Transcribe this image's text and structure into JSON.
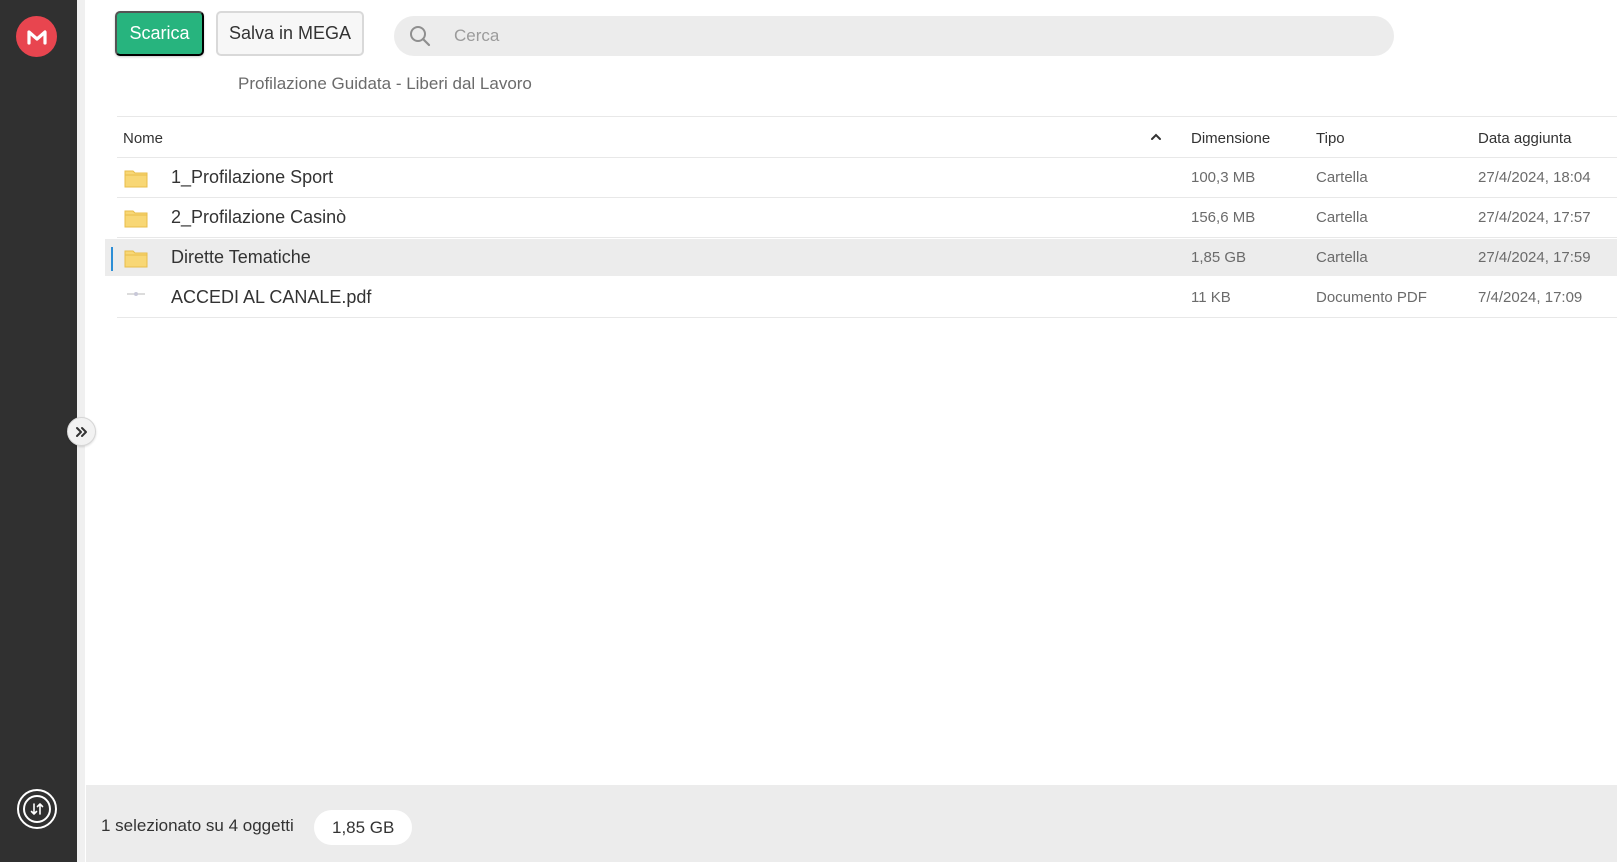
{
  "app": {
    "brand_color": "#e8454f",
    "accent_color": "#27b47e",
    "selection_color": "#2c8ed6"
  },
  "sidebar": {
    "logo_icon": "mega-logo-icon",
    "transfer_icon": "transfers-icon",
    "expand_icon": "chevron-double-right-icon"
  },
  "toolbar": {
    "download_label": "Scarica",
    "save_label": "Salva in MEGA"
  },
  "search": {
    "placeholder": "Cerca",
    "value": ""
  },
  "breadcrumb": {
    "folder_name": "Profilazione Guidata - Liberi dal Lavoro"
  },
  "table": {
    "columns": {
      "name": "Nome",
      "size": "Dimensione",
      "type": "Tipo",
      "date": "Data aggiunta"
    },
    "rows": [
      {
        "icon": "folder-icon",
        "name": "1_Profilazione Sport",
        "size": "100,3 MB",
        "type": "Cartella",
        "date": "27/4/2024, 18:04",
        "selected": false
      },
      {
        "icon": "folder-icon",
        "name": "2_Profilazione Casinò",
        "size": "156,6 MB",
        "type": "Cartella",
        "date": "27/4/2024, 17:57",
        "selected": false
      },
      {
        "icon": "folder-icon",
        "name": "Dirette Tematiche",
        "size": "1,85 GB",
        "type": "Cartella",
        "date": "27/4/2024, 17:59",
        "selected": true
      },
      {
        "icon": "pdf-file-icon",
        "name": "ACCEDI AL CANALE.pdf",
        "size": "11 KB",
        "type": "Documento PDF",
        "date": "7/4/2024, 17:09",
        "selected": false
      }
    ]
  },
  "footer": {
    "selection_text": "1 selezionato su 4 oggetti",
    "selection_size": "1,85 GB"
  }
}
